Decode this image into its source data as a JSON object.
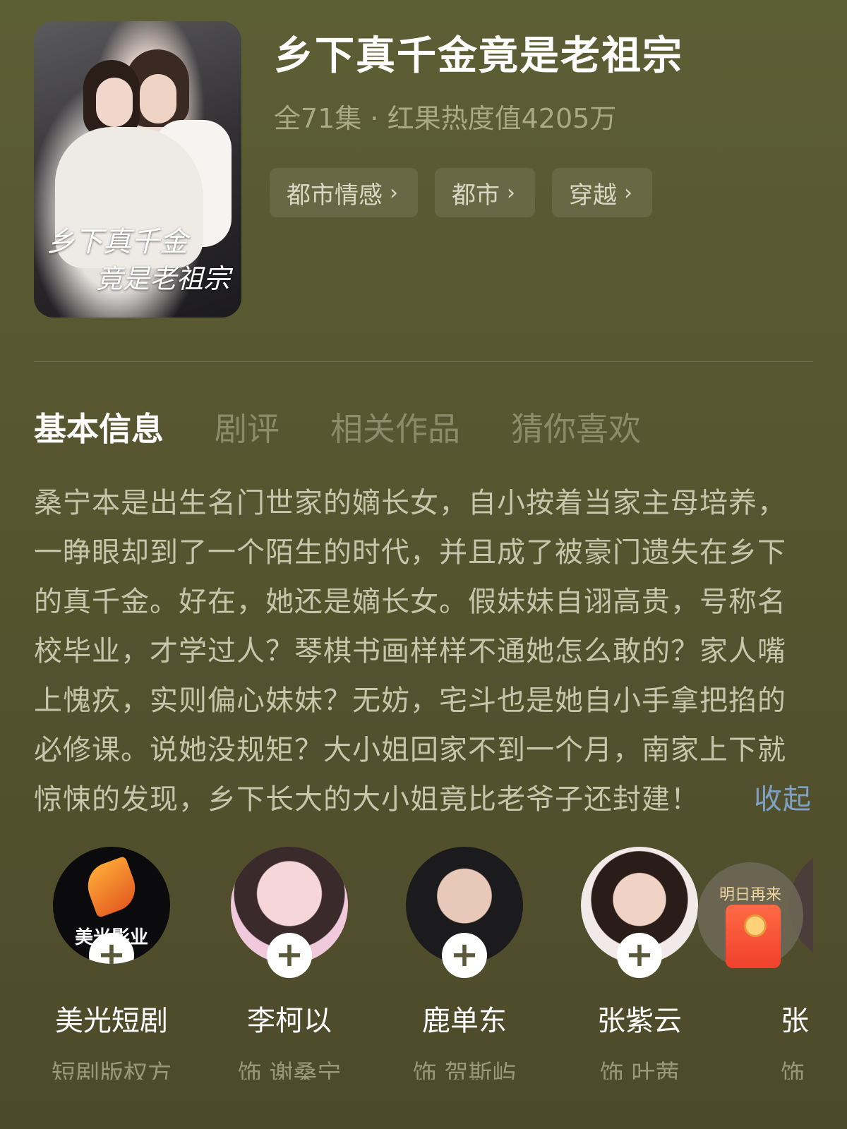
{
  "show": {
    "cover_title_line1": "乡下真千金",
    "cover_title_line2": "竟是老祖宗",
    "title": "乡下真千金竟是老祖宗",
    "meta": "全71集 · 红果热度值4205万",
    "tags": [
      {
        "label": "都市情感"
      },
      {
        "label": "都市"
      },
      {
        "label": "穿越"
      }
    ]
  },
  "tabs": [
    {
      "label": "基本信息",
      "active": true
    },
    {
      "label": "剧评",
      "active": false
    },
    {
      "label": "相关作品",
      "active": false
    },
    {
      "label": "猜你喜欢",
      "active": false
    }
  ],
  "description": {
    "text": "桑宁本是出生名门世家的嫡长女，自小按着当家主母培养，一睁眼却到了一个陌生的时代，并且成了被豪门遗失在乡下的真千金。好在，她还是嫡长女。假妹妹自诩高贵，号称名校毕业，才学过人？琴棋书画样样不通她怎么敢的？家人嘴上愧疚，实则偏心妹妹？无妨，宅斗也是她自小手拿把掐的必修课。说她没规矩？大小姐回家不到一个月，南家上下就惊悚的发现，乡下长大的大小姐竟比老爷子还封建！",
    "collapse_label": "收起"
  },
  "cast": [
    {
      "name": "美光短剧",
      "role": "短剧版权方",
      "logo_text": "美光影业"
    },
    {
      "name": "李柯以",
      "role": "饰 谢桑宁"
    },
    {
      "name": "鹿单东",
      "role": "饰 贺斯屿"
    },
    {
      "name": "张紫云",
      "role": "饰 叶茜"
    },
    {
      "name": "张",
      "role": "饰"
    }
  ],
  "reward_popup": {
    "label": "明日再来",
    "icon": "red-envelope-icon"
  },
  "colors": {
    "background": "#5a5a32",
    "accent_link": "#7fa1c6"
  }
}
